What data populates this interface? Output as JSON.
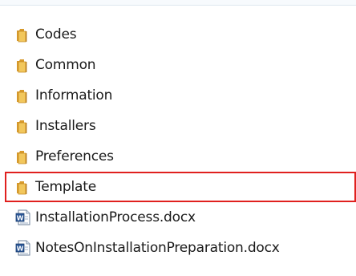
{
  "items": [
    {
      "label": "Codes",
      "type": "folder",
      "icon": "folder-icon"
    },
    {
      "label": "Common",
      "type": "folder",
      "icon": "folder-icon"
    },
    {
      "label": "Information",
      "type": "folder",
      "icon": "folder-icon"
    },
    {
      "label": "Installers",
      "type": "folder",
      "icon": "folder-icon"
    },
    {
      "label": "Preferences",
      "type": "folder",
      "icon": "folder-icon"
    },
    {
      "label": "Template",
      "type": "folder",
      "icon": "folder-icon",
      "highlighted": true
    },
    {
      "label": "InstallationProcess.docx",
      "type": "document",
      "icon": "word-document-icon"
    },
    {
      "label": "NotesOnInstallationPreparation.docx",
      "type": "document",
      "icon": "word-document-icon"
    }
  ],
  "colors": {
    "highlight_border": "#e0201e",
    "folder": "#e8b84a",
    "word_blue": "#2b5797"
  }
}
